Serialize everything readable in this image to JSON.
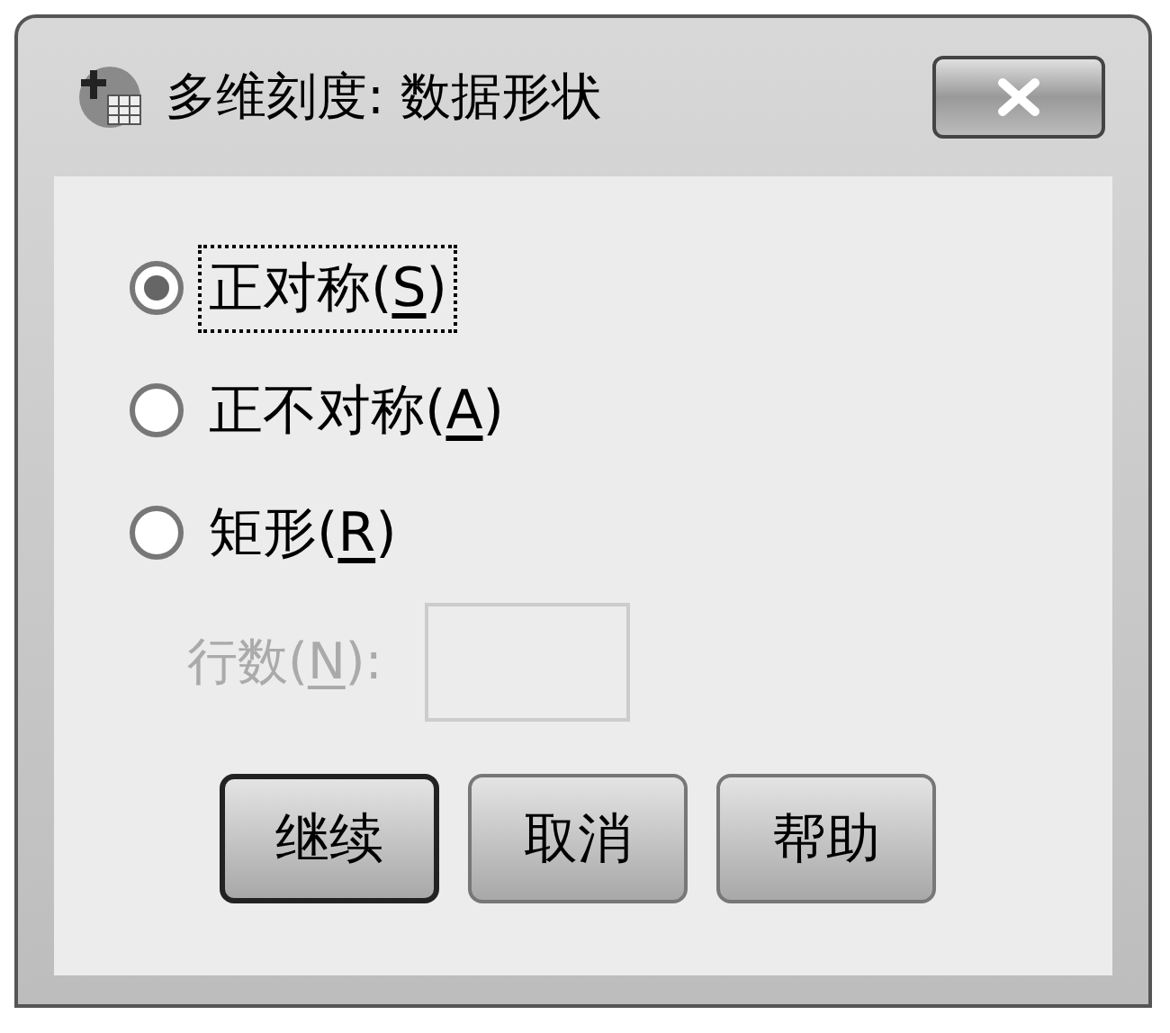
{
  "window": {
    "title": "多维刻度: 数据形状"
  },
  "options": [
    {
      "before": "正对称(",
      "key": "S",
      "after": ")",
      "selected": true,
      "focused": true
    },
    {
      "before": "正不对称(",
      "key": "A",
      "after": ")",
      "selected": false,
      "focused": false
    },
    {
      "before": "矩形(",
      "key": "R",
      "after": ")",
      "selected": false,
      "focused": false
    }
  ],
  "rows_field": {
    "before": "行数(",
    "key": "N",
    "after": "):",
    "disabled": true
  },
  "buttons": [
    {
      "label": "继续",
      "default": true
    },
    {
      "label": "取消",
      "default": false
    },
    {
      "label": "帮助",
      "default": false
    }
  ]
}
